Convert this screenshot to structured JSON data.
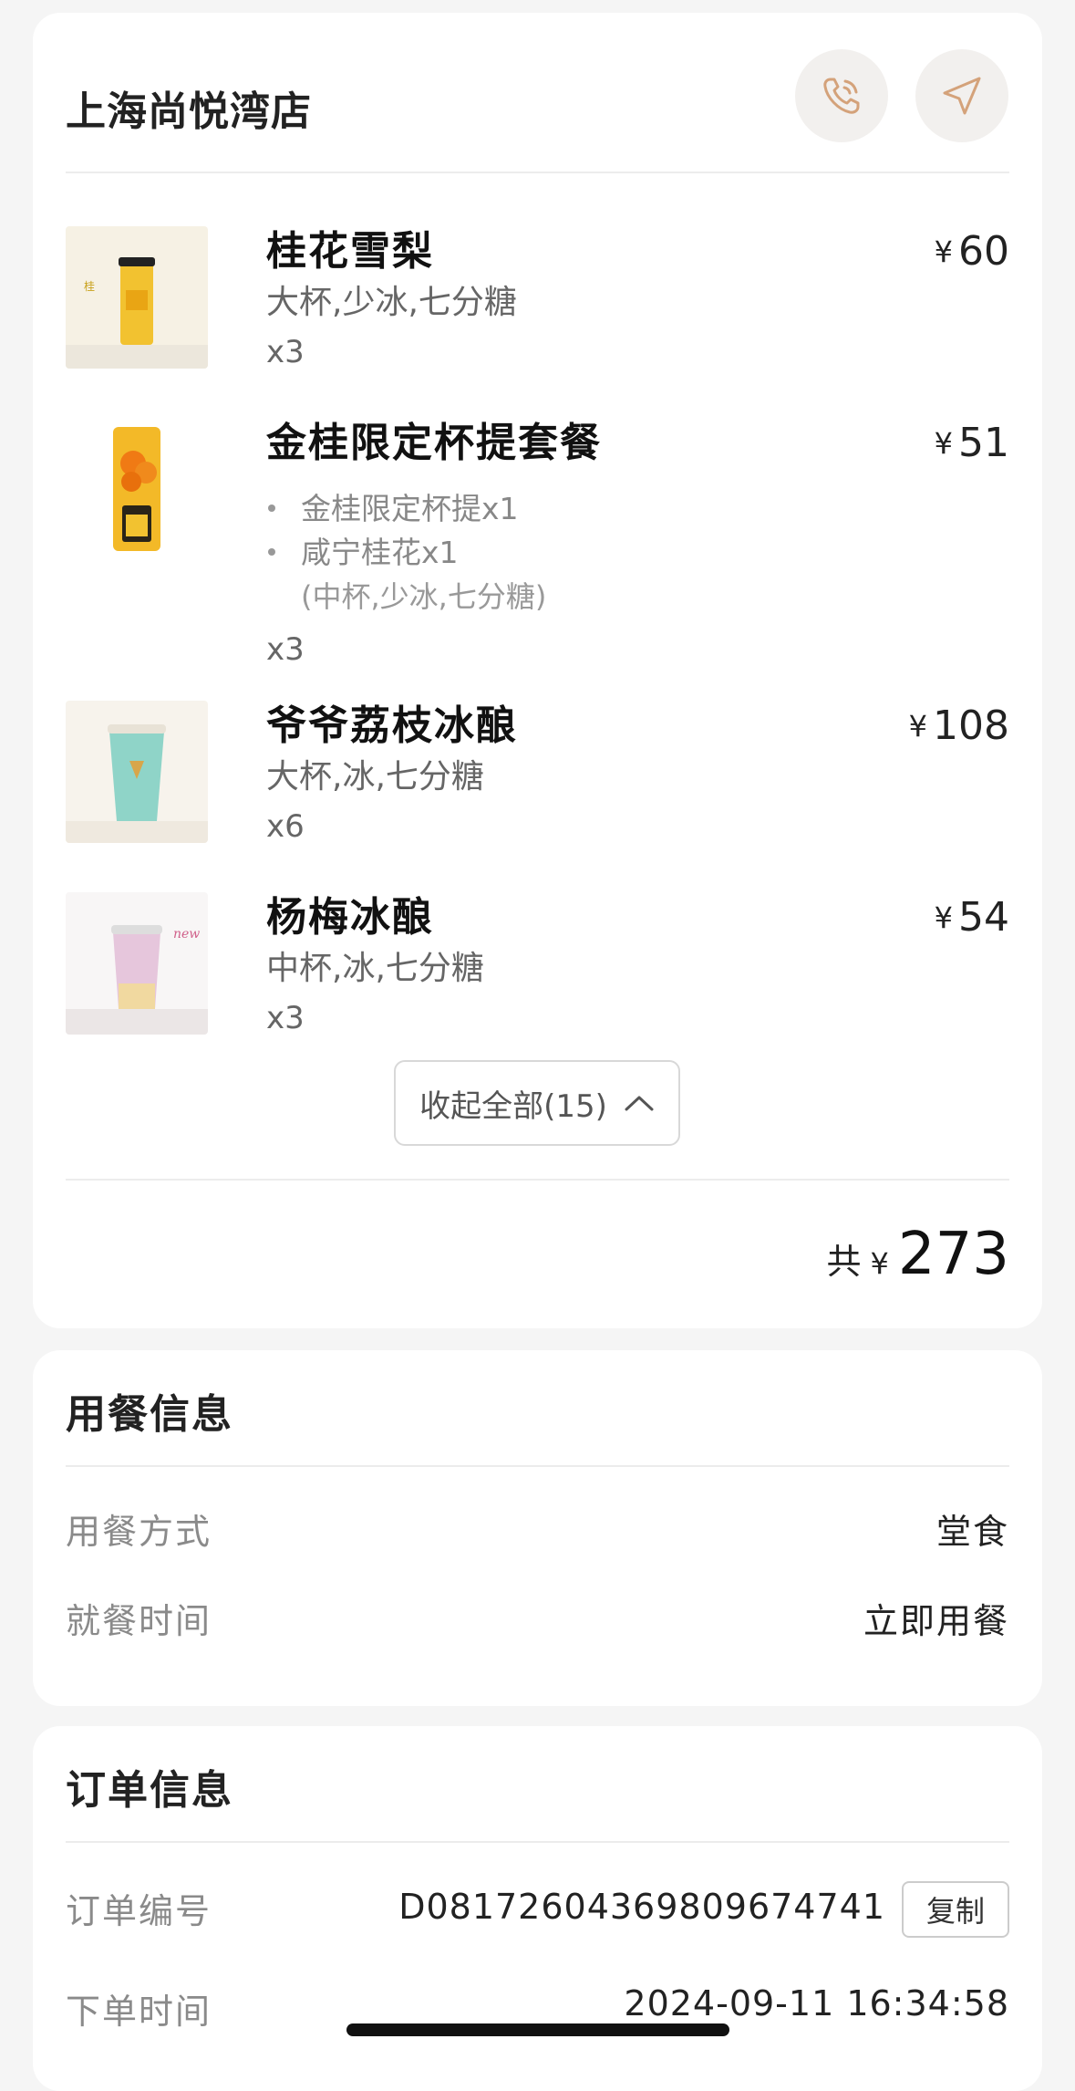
{
  "store": {
    "name": "上海尚悦湾店",
    "phone_icon": "phone-icon",
    "nav_icon": "navigation-arrow-icon",
    "accent_color": "#d4a27a"
  },
  "items": [
    {
      "name": "桂花雪梨",
      "price": "60",
      "spec": "大杯,少冰,七分糖",
      "qty": "x3"
    },
    {
      "name": "金桂限定杯提套餐",
      "price": "51",
      "qty": "x3",
      "sub_items": [
        {
          "label": "金桂限定杯提x1"
        },
        {
          "label": "咸宁桂花x1",
          "spec": "(中杯,少冰,七分糖)"
        }
      ]
    },
    {
      "name": "爷爷荔枝冰酿",
      "price": "108",
      "spec": "大杯,冰,七分糖",
      "qty": "x6"
    },
    {
      "name": "杨梅冰酿",
      "price": "54",
      "spec": "中杯,冰,七分糖",
      "qty": "x3"
    }
  ],
  "currency": "¥",
  "collapse_label": "收起全部(15)",
  "total": {
    "label": "共",
    "value": "273"
  },
  "dining": {
    "title": "用餐信息",
    "rows": [
      {
        "label": "用餐方式",
        "value": "堂食"
      },
      {
        "label": "就餐时间",
        "value": "立即用餐"
      }
    ]
  },
  "order": {
    "title": "订单信息",
    "number_label": "订单编号",
    "number": "D0817260436980967474​1",
    "copy_label": "复制",
    "time_label": "下单时间",
    "time": "2024-09-11 16:34:58"
  }
}
